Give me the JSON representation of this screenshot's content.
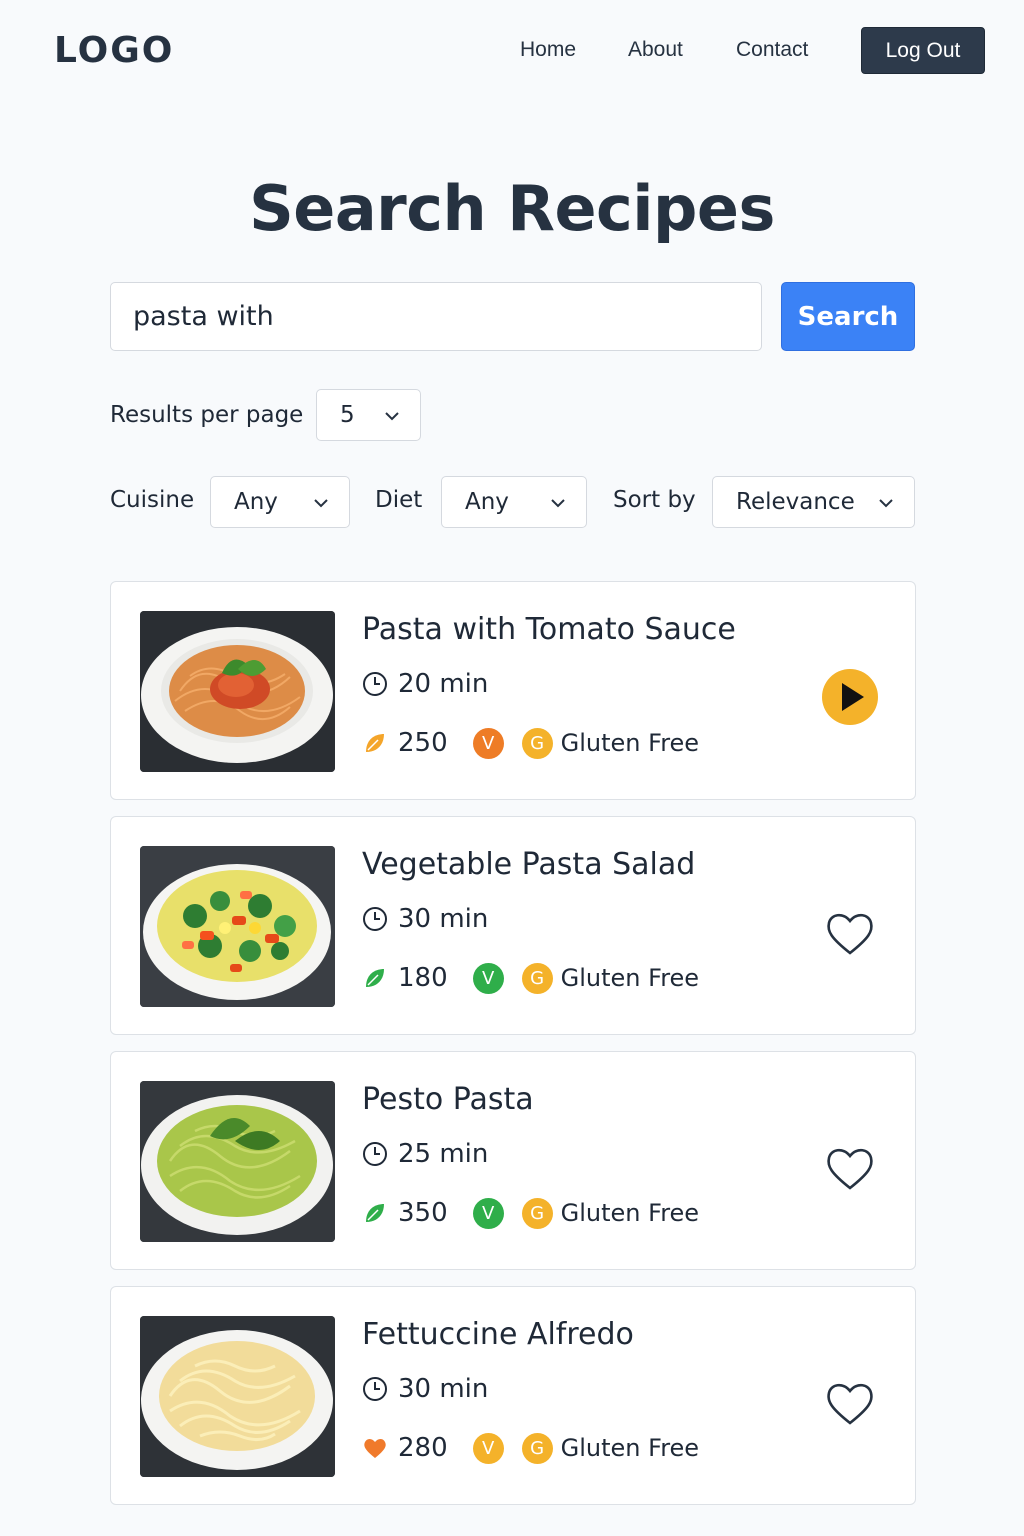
{
  "header": {
    "logo": "LOGO",
    "nav": [
      {
        "label": "Home"
      },
      {
        "label": "About"
      },
      {
        "label": "Contact"
      }
    ],
    "logout_label": "Log Out"
  },
  "main": {
    "title": "Search Recipes",
    "search": {
      "value": "pasta with",
      "button_label": "Search"
    },
    "results_per_page": {
      "label": "Results per page",
      "value": "5"
    },
    "filters": {
      "cuisine": {
        "label": "Cuisine",
        "value": "Any"
      },
      "diet": {
        "label": "Diet",
        "value": "Any"
      },
      "sort": {
        "label": "Sort by",
        "value": "Relevance"
      }
    }
  },
  "recipes": [
    {
      "title": "Pasta with Tomato Sauce",
      "time": "20 min",
      "calories": "250",
      "diet_badge": "V",
      "gf_badge": "G",
      "gf_label": "Gluten Free",
      "action": "play-icon",
      "cal_icon": "leaf-icon",
      "cal_color": "#f4a52a",
      "v_color": "#ee7c26",
      "dish": "tomato"
    },
    {
      "title": "Vegetable Pasta Salad",
      "time": "30 min",
      "calories": "180",
      "diet_badge": "V",
      "gf_badge": "G",
      "gf_label": "Gluten Free",
      "action": "heart-icon",
      "cal_icon": "leaf-icon",
      "cal_color": "#2fae4a",
      "v_color": "#2fae4a",
      "dish": "salad"
    },
    {
      "title": "Pesto Pasta",
      "time": "25 min",
      "calories": "350",
      "diet_badge": "V",
      "gf_badge": "G",
      "gf_label": "Gluten Free",
      "action": "heart-icon",
      "cal_icon": "leaf-icon",
      "cal_color": "#2fae4a",
      "v_color": "#2fae4a",
      "dish": "pesto"
    },
    {
      "title": "Fettuccine Alfredo",
      "time": "30 min",
      "calories": "280",
      "diet_badge": "V",
      "gf_badge": "G",
      "gf_label": "Gluten Free",
      "action": "heart-icon",
      "cal_icon": "heart-icon",
      "cal_color": "#f07a2b",
      "v_color": "#f4b22a",
      "dish": "alfredo"
    }
  ],
  "colors": {
    "accent": "#3b82f6",
    "dark": "#2d3a4b",
    "gf_badge": "#f4b22a",
    "play": "#f4b22a"
  }
}
